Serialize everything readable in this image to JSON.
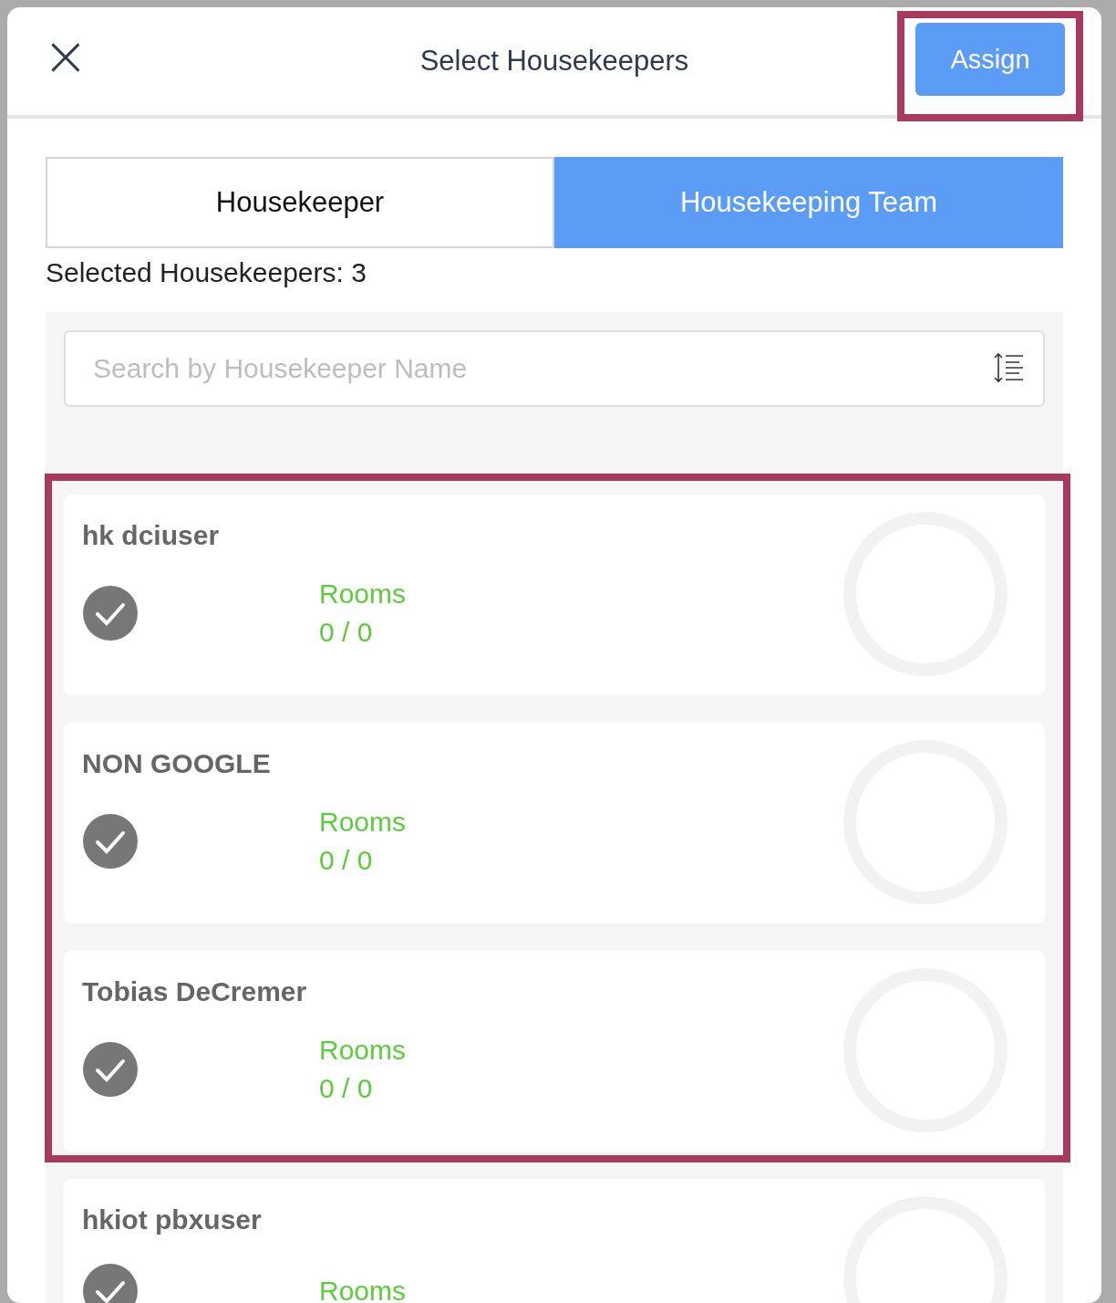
{
  "dialog": {
    "title": "Select Housekeepers",
    "close": "×",
    "action": "Assign"
  },
  "tabs": [
    {
      "label": "Housekeeper",
      "selected": false
    },
    {
      "label": "Housekeeping Team",
      "selected": true
    }
  ],
  "selected_count": "Selected Housekeepers: 3",
  "search": {
    "placeholder": "Search by Housekeeper Name"
  },
  "housekeepers": [
    {
      "name": "hk dciuser",
      "selected": true,
      "rooms_label": "Rooms",
      "rooms": "0 / 0"
    },
    {
      "name": "NON GOOGLE",
      "selected": true,
      "rooms_label": "Rooms",
      "rooms": "0 / 0"
    },
    {
      "name": "Tobias DeCremer",
      "selected": true,
      "rooms_label": "Rooms",
      "rooms": "0 / 0"
    },
    {
      "name": "hkiot pbxuser",
      "selected": true,
      "rooms_label": "Rooms"
    }
  ]
}
